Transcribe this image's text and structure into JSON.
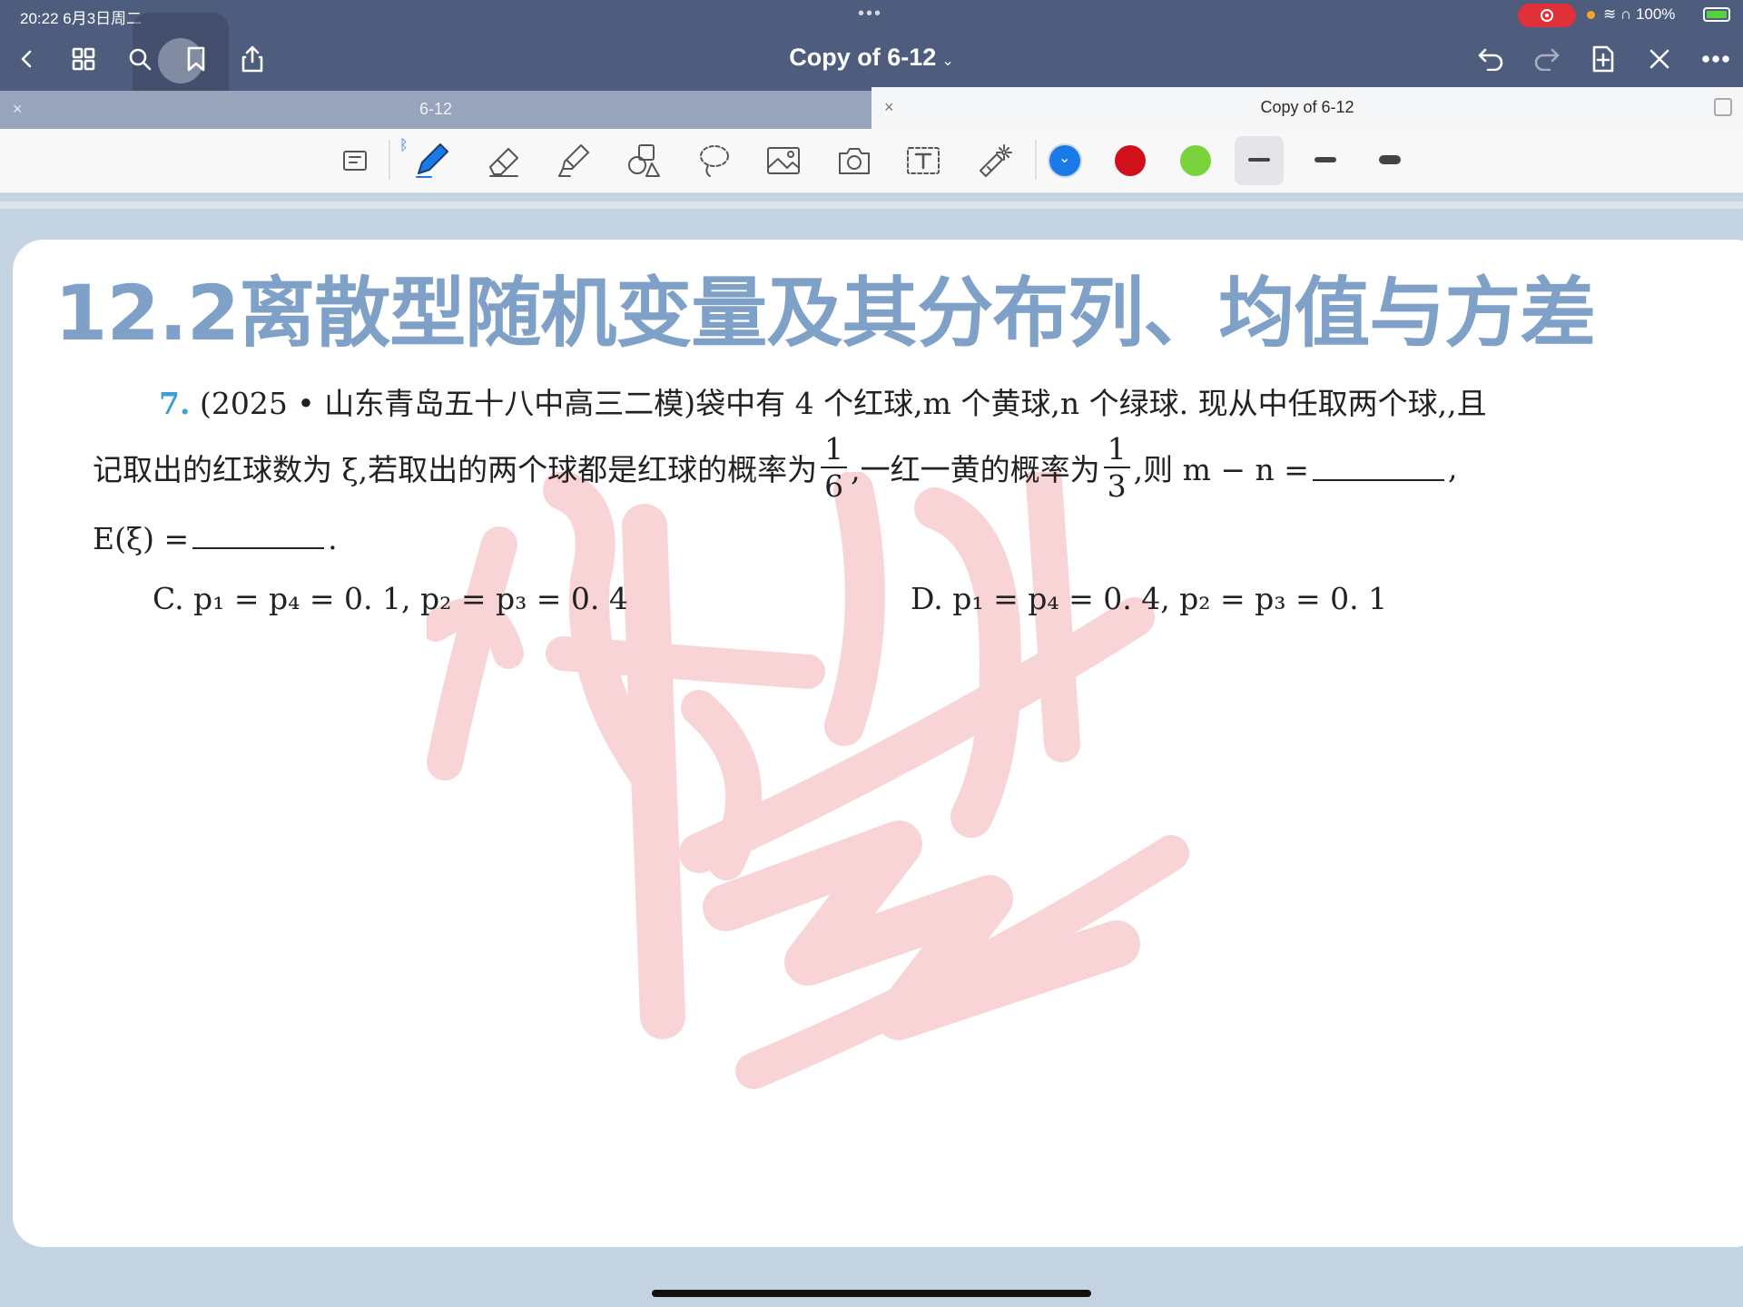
{
  "status_bar": {
    "time_date": "20:22  6月3日周二",
    "battery_text": "100%"
  },
  "nav": {
    "title": "Copy of 6-12",
    "icons": [
      "chevron-left-icon",
      "grid-icon",
      "search-icon",
      "bookmark-icon",
      "share-icon",
      "undo-icon",
      "redo-icon",
      "add-page-icon",
      "close-icon",
      "more-icon"
    ]
  },
  "tabs": [
    {
      "label": "6-12",
      "active": false
    },
    {
      "label": "Copy of 6-12",
      "active": true
    }
  ],
  "toolbar": {
    "tools": [
      "page-view-icon",
      "pen-icon",
      "eraser-icon",
      "highlighter-icon",
      "shapes-icon",
      "lasso-icon",
      "image-icon",
      "camera-icon",
      "textbox-icon",
      "laser-pointer-icon"
    ],
    "colors": [
      "#1a7be8",
      "#d0101a",
      "#7ad33c"
    ],
    "selected_color": "#1a7be8"
  },
  "document": {
    "heading": "12.2离散型随机变量及其分布列、均值与方差",
    "question_number": "7.",
    "line1": "(2025 • 山东青岛五十八中高三二模)袋中有 4 个红球,m 个黄球,n 个绿球. 现从中任取两个球,,且",
    "line2_a": "记取出的红球数为 ξ,若取出的两个球都是红球的概率为",
    "frac1_num": "1",
    "frac1_den": "6",
    "line2_b": ",一红一黄的概率为",
    "frac2_num": "1",
    "frac2_den": "3",
    "line2_c": ",则 m − n =",
    "line2_d": ",",
    "line3_a": "E(ξ) =",
    "line3_b": ".",
    "option_c": "C.  p₁ = p₄ = 0. 1,  p₂ = p₃ = 0. 4",
    "option_d": "D.  p₁ = p₄ = 0. 4,  p₂ = p₃ = 0. 1"
  }
}
